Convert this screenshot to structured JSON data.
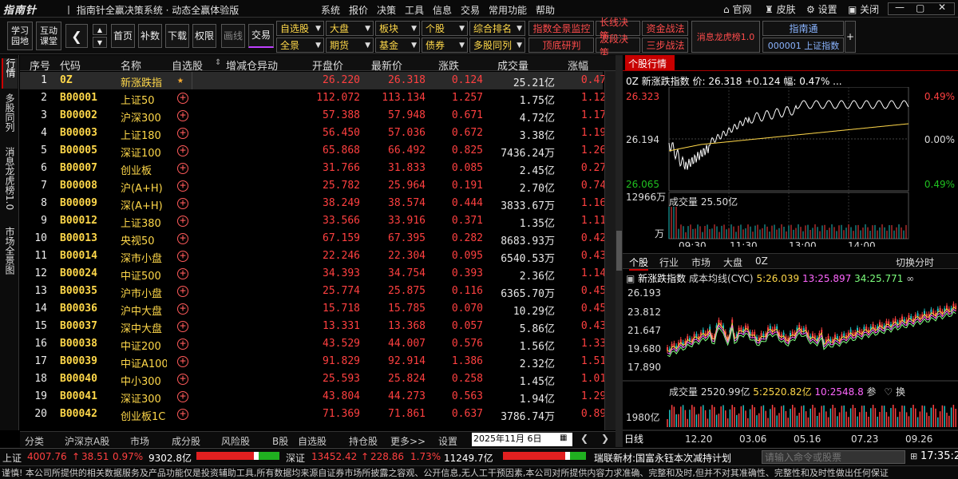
{
  "app": {
    "logo": "指南针",
    "title": "丨 指南针全赢决策系统 · 动态全赢体验版"
  },
  "menu": [
    "系统",
    "报价",
    "决策",
    "工具",
    "信息",
    "交易",
    "常用功能",
    "帮助"
  ],
  "window_buttons": {
    "site": "官网",
    "skin": "皮肤",
    "settings": "设置",
    "close": "关闭"
  },
  "toolbar": {
    "study": "学习\n园地",
    "class": "互动\n课堂",
    "home": "首页",
    "fill": "补数",
    "download": "下载",
    "rights": "权限",
    "draw": "画线",
    "trade": "交易",
    "dropdowns_r1": [
      "自选股",
      "大盘",
      "板块",
      "个股",
      "综合排名"
    ],
    "dropdowns_r2": [
      "全景",
      "期货",
      "基金",
      "债券",
      "多股同列"
    ],
    "func_r1": [
      "指数全景监控",
      "长线决策",
      "资金战法"
    ],
    "func_r2": [
      "顶底研判",
      "波段决策",
      "三步战法"
    ],
    "dragon": "消息龙虎榜1.0",
    "navi": "指南通",
    "navi_code": "000001 上证指数",
    "plus": "+"
  },
  "left_tabs": [
    "行情",
    "多股同列",
    "消息龙虎榜1.0",
    "市场全景图"
  ],
  "table": {
    "headers": [
      "序号",
      "代码",
      "名称",
      "自选股",
      "增减仓异动",
      "开盘价",
      "最新价",
      "涨跌",
      "成交量",
      "涨幅"
    ],
    "rows": [
      [
        "1",
        "0Z",
        "新涨跌指",
        "",
        "",
        "26.220",
        "26.318",
        "0.124",
        "25.21亿",
        "0.47%"
      ],
      [
        "2",
        "B00001",
        "上证50",
        "",
        "",
        "112.072",
        "113.134",
        "1.257",
        "1.75亿",
        "1.12%"
      ],
      [
        "3",
        "B00002",
        "沪深300",
        "",
        "",
        "57.388",
        "57.948",
        "0.671",
        "4.72亿",
        "1.17%"
      ],
      [
        "4",
        "B00003",
        "上证180",
        "",
        "",
        "56.450",
        "57.036",
        "0.672",
        "3.38亿",
        "1.19%"
      ],
      [
        "5",
        "B00005",
        "深证100",
        "",
        "",
        "65.868",
        "66.492",
        "0.825",
        "7436.24万",
        "1.26%"
      ],
      [
        "6",
        "B00007",
        "创业板",
        "",
        "",
        "31.766",
        "31.833",
        "0.085",
        "2.45亿",
        "0.27%"
      ],
      [
        "7",
        "B00008",
        "沪(A+H)",
        "",
        "",
        "25.782",
        "25.964",
        "0.191",
        "2.70亿",
        "0.74%"
      ],
      [
        "8",
        "B00009",
        "深(A+H)",
        "",
        "",
        "38.249",
        "38.574",
        "0.444",
        "3833.67万",
        "1.16%"
      ],
      [
        "9",
        "B00012",
        "上证380",
        "",
        "",
        "33.566",
        "33.916",
        "0.371",
        "1.35亿",
        "1.11%"
      ],
      [
        "10",
        "B00013",
        "央视50",
        "",
        "",
        "67.159",
        "67.395",
        "0.282",
        "8683.93万",
        "0.42%"
      ],
      [
        "11",
        "B00014",
        "深市小盘",
        "",
        "",
        "22.246",
        "22.304",
        "0.095",
        "6540.53万",
        "0.43%"
      ],
      [
        "12",
        "B00024",
        "中证500",
        "",
        "",
        "34.393",
        "34.754",
        "0.393",
        "2.36亿",
        "1.14%"
      ],
      [
        "13",
        "B00035",
        "沪市小盘",
        "",
        "",
        "25.774",
        "25.875",
        "0.116",
        "6365.70万",
        "0.45%"
      ],
      [
        "14",
        "B00036",
        "沪中大盘",
        "",
        "",
        "15.718",
        "15.785",
        "0.070",
        "10.29亿",
        "0.45%"
      ],
      [
        "15",
        "B00037",
        "深中大盘",
        "",
        "",
        "13.331",
        "13.368",
        "0.057",
        "5.86亿",
        "0.43%"
      ],
      [
        "16",
        "B00038",
        "中证200",
        "",
        "",
        "43.529",
        "44.007",
        "0.576",
        "1.56亿",
        "1.33%"
      ],
      [
        "17",
        "B00039",
        "中证A100",
        "",
        "",
        "91.829",
        "92.914",
        "1.386",
        "2.32亿",
        "1.51%"
      ],
      [
        "18",
        "B00040",
        "中小300",
        "",
        "",
        "25.593",
        "25.824",
        "0.258",
        "1.45亿",
        "1.01%"
      ],
      [
        "19",
        "B00041",
        "深证300",
        "",
        "",
        "43.804",
        "44.273",
        "0.563",
        "1.94亿",
        "1.29%"
      ],
      [
        "20",
        "B00042",
        "创业板1C",
        "",
        "",
        "71.369",
        "71.861",
        "0.637",
        "3786.74万",
        "0.89%"
      ]
    ]
  },
  "bottom_tabs": [
    "分类",
    "沪深京A股",
    "市场",
    "成分股",
    "风险股",
    "B股",
    "自选股",
    "持仓股",
    "更多>>"
  ],
  "bottom_settings": "设置",
  "bottom_date": "2025年11月 6日",
  "right": {
    "tab_title": "个股行情",
    "quote_header": "0Z 新涨跌指数 价: 26.318 +0.124 幅: 0.47% ...",
    "price_hi": "26.323",
    "price_mid": "26.194",
    "price_lo": "26.065",
    "pct_hi": "0.49%",
    "pct_mid": "0.00%",
    "pct_lo": "0.49%",
    "vol_top": "12966万",
    "vol_unit": "万",
    "vol_label": "成交量 25.50亿",
    "time_ticks": [
      "09:30",
      "11:30",
      "13:00",
      "14:00"
    ],
    "sub_tabs": [
      "个股",
      "行业",
      "市场",
      "大盘",
      "0Z"
    ],
    "switch_cycle": "切换分时",
    "kline_title": "新涨跌指数",
    "cyc_label": "成本均线(CYC)",
    "cyc5": "5:26.039",
    "cyc13": "13:25.897",
    "cyc34": "34:25.771",
    "k_prices": [
      "26.193",
      "23.812",
      "21.647",
      "19.680",
      "17.890"
    ],
    "kvol_label": "成交量",
    "kvol_val": "2520.99亿",
    "kvol_5": "5:2520.82亿",
    "kvol_10": "10:2548.8",
    "kvol_params": "参",
    "kvol_switch": "换",
    "kvol_axis": "1980亿",
    "k_period": "日线",
    "k_dates": [
      "12.20",
      "03.06",
      "05.16",
      "07.23",
      "09.26"
    ]
  },
  "status": {
    "sh_label": "上证",
    "sh_value": "4007.76",
    "sh_change": "38.51",
    "sh_pct": "0.97%",
    "sh_amount": "9302.8亿",
    "sz_label": "深证",
    "sz_value": "13452.42",
    "sz_change": "228.86",
    "sz_pct": "1.73%",
    "sz_amount": "11249.7亿",
    "news": "瑞联新材:国富永钰本次减持计划",
    "cmd_placeholder": "请输入命令或股票",
    "time": "17:35:25"
  },
  "notice": "谨慎! 本公司所提供的相关数据服务及产品功能仅是投资辅助工具,所有数据均来源自证券市场所披露之容观、公开信息,无人工干预因素,本公司对所提供内容力求准确、完整和及时,但并不对其准确性、完整性和及时性做出任何保证"
}
